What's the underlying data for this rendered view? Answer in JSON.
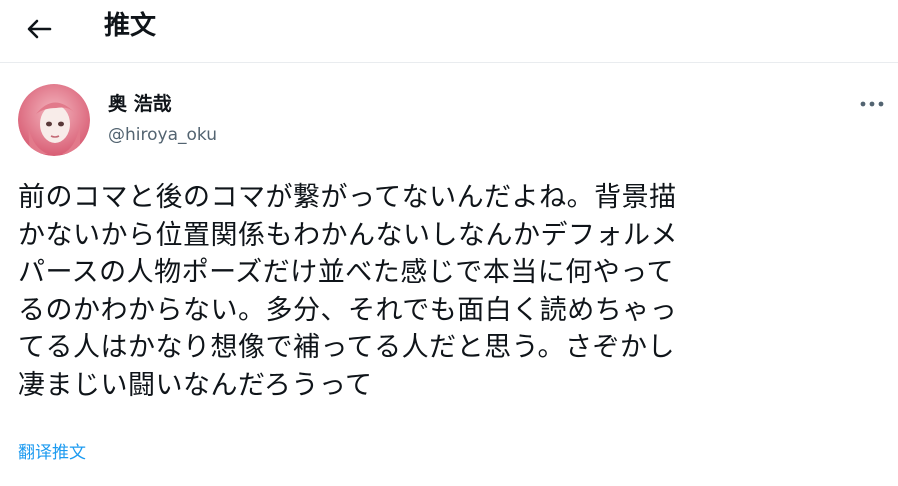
{
  "header": {
    "back_icon": "arrow-left-icon",
    "title": "推文"
  },
  "tweet": {
    "author": {
      "name": "奥 浩哉",
      "handle": "@hiroya_oku",
      "avatar": "avatar-image"
    },
    "more_icon": "more-horizontal-icon",
    "text_lines": [
      "前のコマと後のコマが繋がってないんだよね。背景描",
      "かないから位置関係もわかんないしなんかデフォルメ",
      "パースの人物ポーズだけ並べた感じで本当に何やって",
      "るのかわからない。多分、それでも面白く読めちゃっ",
      "てる人はかなり想像で補ってる人だと思う。さぞかし",
      "凄まじい闘いなんだろうって"
    ],
    "translate_label": "翻译推文"
  },
  "colors": {
    "text": "#0f1419",
    "secondary": "#536471",
    "link": "#1d9bf0",
    "divider": "#e9ecef"
  }
}
